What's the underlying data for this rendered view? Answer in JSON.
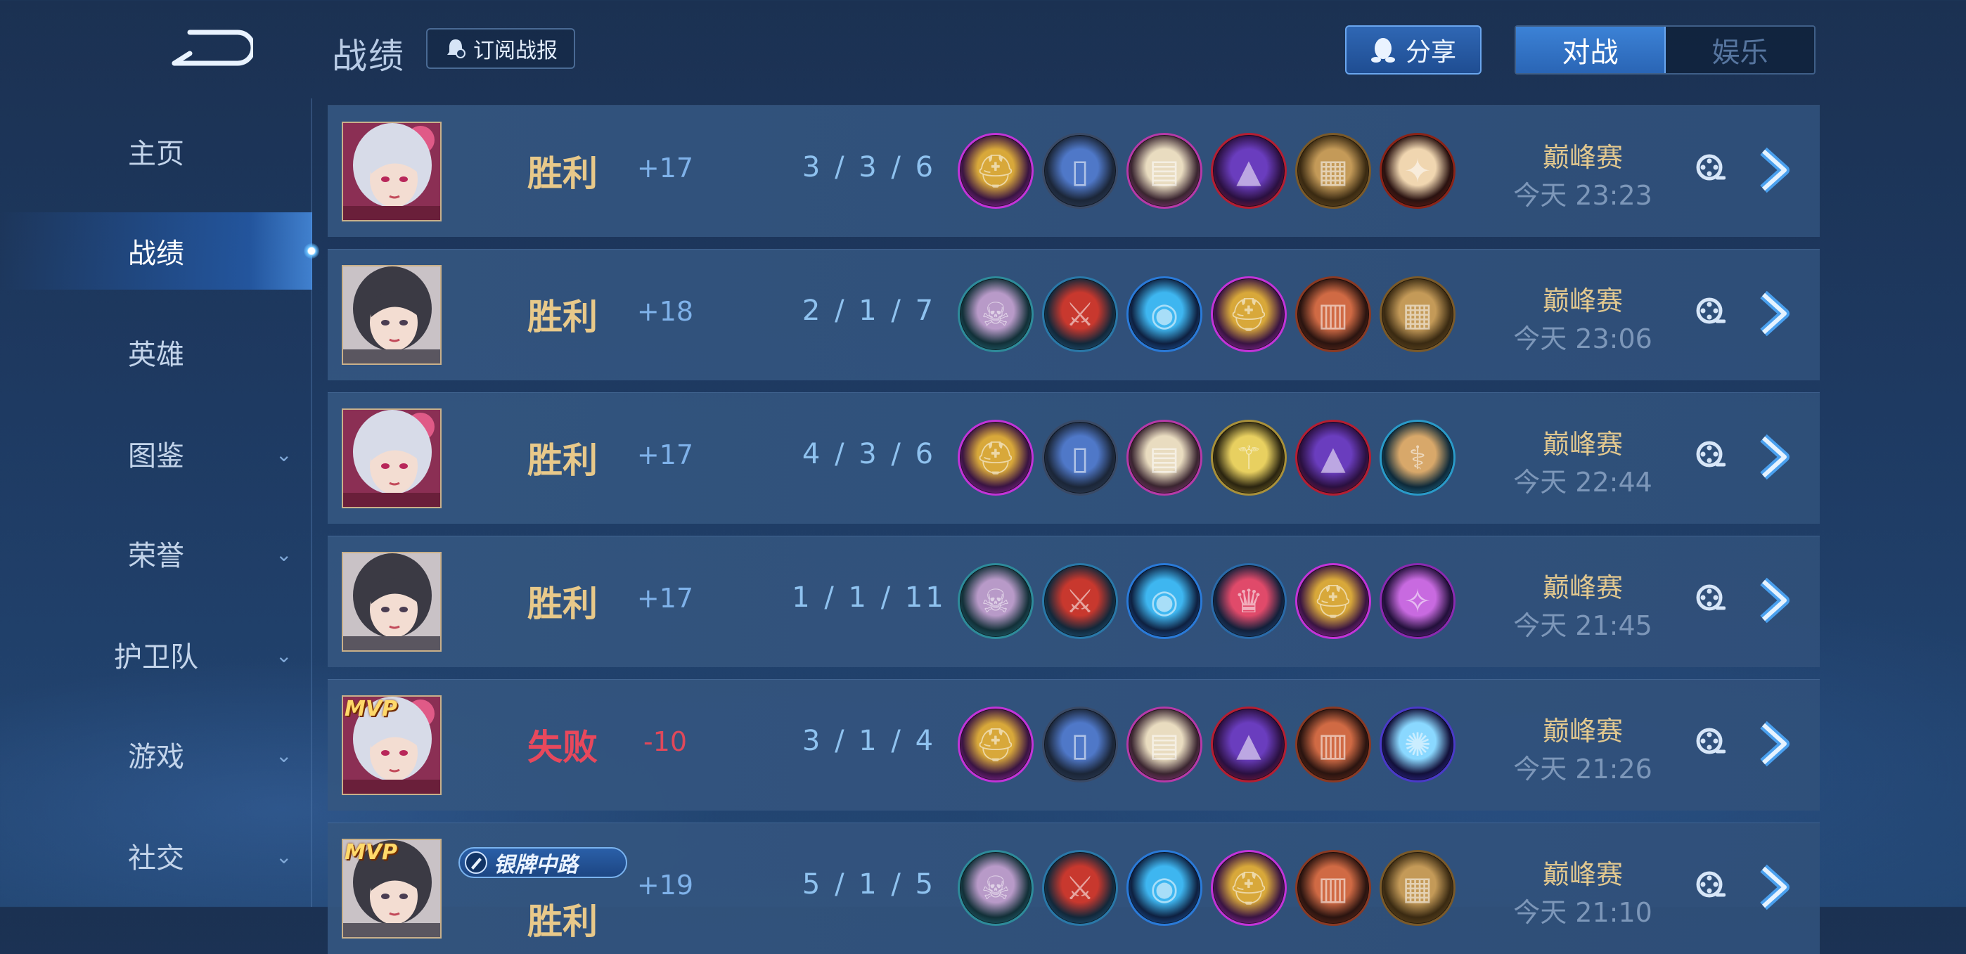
{
  "header": {
    "title": "战绩",
    "subscribe_label": "订阅战报",
    "share_label": "分享",
    "mode_tabs": [
      {
        "label": "对战",
        "active": true
      },
      {
        "label": "娱乐",
        "active": false
      }
    ]
  },
  "sidebar": {
    "items": [
      {
        "label": "主页",
        "active": false,
        "expandable": false
      },
      {
        "label": "战绩",
        "active": true,
        "expandable": false
      },
      {
        "label": "英雄",
        "active": false,
        "expandable": false
      },
      {
        "label": "图鉴",
        "active": false,
        "expandable": true
      },
      {
        "label": "荣誉",
        "active": false,
        "expandable": true
      },
      {
        "label": "护卫队",
        "active": false,
        "expandable": true
      },
      {
        "label": "游戏",
        "active": false,
        "expandable": true
      },
      {
        "label": "社交",
        "active": false,
        "expandable": true
      }
    ]
  },
  "matches": [
    {
      "hero": "silver-hair-mage",
      "mvp": false,
      "result": "胜利",
      "result_type": "win",
      "score": "+17",
      "kda": "3 / 3 / 6",
      "items": [
        "gold-scarab",
        "blue-boots",
        "spell-book",
        "wizard-hat",
        "wooden-tome",
        "red-seal"
      ],
      "mode": "巅峰赛",
      "time": "今天 23:23"
    },
    {
      "hero": "dark-hair-mage",
      "mvp": false,
      "result": "胜利",
      "result_type": "win",
      "score": "+18",
      "kda": "2 / 1 / 7",
      "items": [
        "skull-mask",
        "red-blade",
        "blue-orb",
        "gold-scarab",
        "red-tome",
        "wooden-tome"
      ],
      "mode": "巅峰赛",
      "time": "今天 23:06"
    },
    {
      "hero": "silver-hair-mage",
      "mvp": false,
      "result": "胜利",
      "result_type": "win",
      "score": "+17",
      "kda": "4 / 3 / 6",
      "items": [
        "gold-scarab",
        "blue-boots",
        "spell-book",
        "gold-scepter",
        "wizard-hat",
        "blue-staff"
      ],
      "mode": "巅峰赛",
      "time": "今天 22:44"
    },
    {
      "hero": "dark-hair-mage",
      "mvp": false,
      "result": "胜利",
      "result_type": "win",
      "score": "+17",
      "kda": "1 / 1 / 11",
      "items": [
        "skull-mask",
        "red-blade",
        "blue-orb",
        "gem-crown",
        "gold-scarab",
        "purple-wand"
      ],
      "mode": "巅峰赛",
      "time": "今天 21:45"
    },
    {
      "hero": "silver-hair-mage",
      "mvp": true,
      "mvp_label": "MVP",
      "result": "失败",
      "result_type": "loss",
      "score": "-10",
      "kda": "3 / 1 / 4",
      "items": [
        "gold-scarab",
        "blue-boots",
        "spell-book",
        "wizard-hat",
        "red-tome",
        "star-orb"
      ],
      "mode": "巅峰赛",
      "time": "今天 21:26"
    },
    {
      "hero": "dark-hair-mage",
      "mvp": true,
      "mvp_label": "MVP",
      "rank_badge": "银牌中路",
      "result": "胜利",
      "result_type": "win",
      "score": "+19",
      "kda": "5 / 1 / 5",
      "items": [
        "skull-mask",
        "red-blade",
        "blue-orb",
        "gold-scarab",
        "red-tome",
        "wooden-tome"
      ],
      "mode": "巅峰赛",
      "time": "今天 21:10"
    }
  ],
  "colors": {
    "win": "#e8c98a",
    "loss": "#e8485c",
    "accent": "#3c82d6",
    "gold_text": "#e2c88f"
  }
}
